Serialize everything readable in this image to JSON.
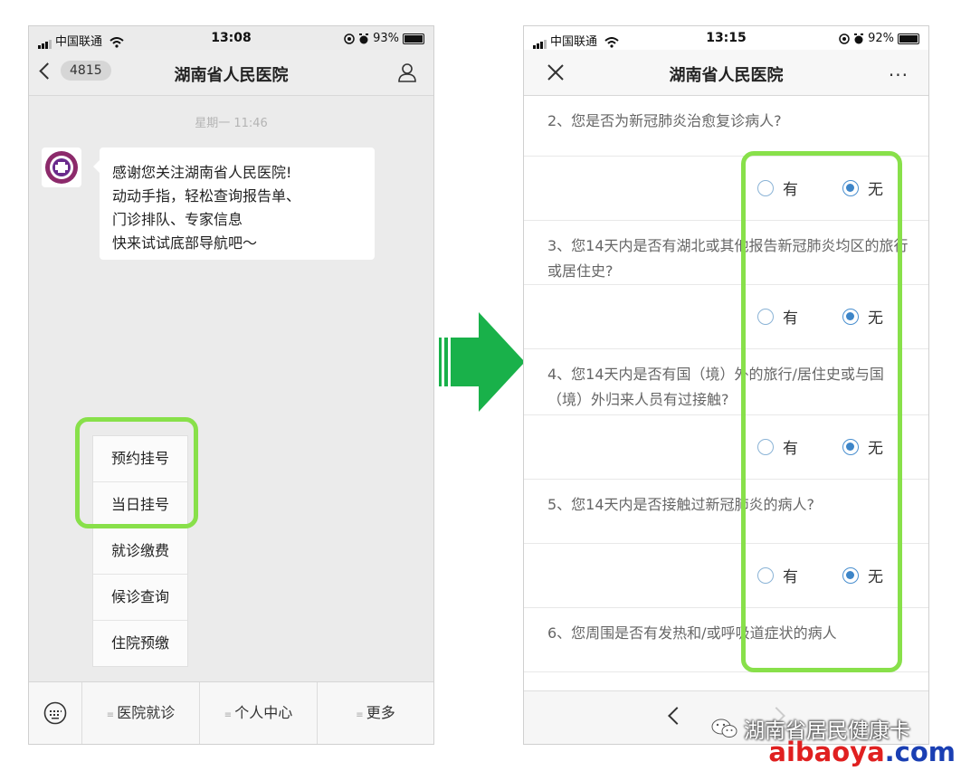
{
  "left_phone": {
    "status": {
      "carrier": "中国联通",
      "time": "13:08",
      "battery": "93%"
    },
    "header": {
      "back_count": "4815",
      "title": "湖南省人民医院"
    },
    "timestamp": "星期一 11:46",
    "message_lines": [
      "感谢您关注湖南省人民医院!",
      " 动动手指，轻松查询报告单、",
      "门诊排队、专家信息",
      " 快来试试底部导航吧～"
    ],
    "popup_menu": [
      "预约挂号",
      "当日挂号",
      "就诊缴费",
      "候诊查询",
      "住院预缴"
    ],
    "bottom_menu": [
      "医院就诊",
      "个人中心",
      "更多"
    ]
  },
  "right_phone": {
    "status": {
      "carrier": "中国联通",
      "time": "13:15",
      "battery": "92%"
    },
    "header": {
      "title": "湖南省人民医院",
      "more": "···"
    },
    "questions": [
      {
        "text": "2、您是否为新冠肺炎治愈复诊病人?",
        "selected": "无"
      },
      {
        "text": "3、您14天内是否有湖北或其他报告新冠肺炎均区的旅行或居住史?",
        "selected": "无"
      },
      {
        "text": "4、您14天内是否有国（境）外的旅行/居住史或与国（境）外归来人员有过接触?",
        "selected": "无"
      },
      {
        "text": "5、您14天内是否接触过新冠肺炎的病人?",
        "selected": "无"
      },
      {
        "text": "6、您周围是否有发热和/或呼吸道症状的病人"
      }
    ],
    "option_yes": "有",
    "option_no": "无"
  },
  "watermark": {
    "account": "湖南省居民健康卡",
    "site_red": "aibaoya",
    "site_blue": ".com"
  },
  "colors": {
    "highlight": "#88e04a",
    "arrow": "#19b14a",
    "radio_checked": "#3d85c8"
  }
}
